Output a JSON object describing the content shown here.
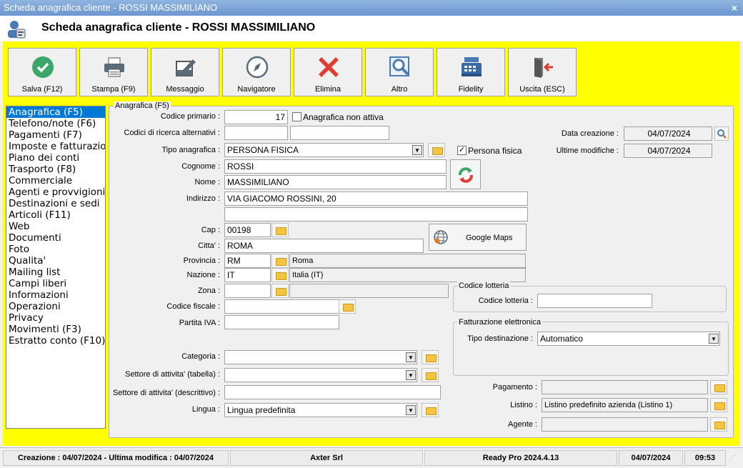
{
  "window": {
    "title": "Scheda anagrafica cliente - ROSSI MASSIMILIANO",
    "close": "×"
  },
  "header": {
    "title": "Scheda anagrafica cliente - ROSSI MASSIMILIANO"
  },
  "toolbar": [
    {
      "label": "Salva (F12)",
      "icon": "check-icon"
    },
    {
      "label": "Stampa (F9)",
      "icon": "printer-icon"
    },
    {
      "label": "Messaggio",
      "icon": "message-icon"
    },
    {
      "label": "Navigatore",
      "icon": "compass-icon"
    },
    {
      "label": "Elimina",
      "icon": "delete-icon"
    },
    {
      "label": "Altro",
      "icon": "magnifier-icon"
    },
    {
      "label": "Fidelity",
      "icon": "register-icon"
    },
    {
      "label": "Uscita (ESC)",
      "icon": "exit-icon"
    }
  ],
  "nav": [
    "Anagrafica (F5)",
    "Telefono/note (F6)",
    "Pagamenti (F7)",
    "Imposte e fatturazio",
    "Piano dei conti",
    "Trasporto (F8)",
    "Commerciale",
    "Agenti e provvigioni",
    "Destinazioni e sedi",
    "Articoli (F11)",
    "Web",
    "Documenti",
    "Foto",
    "Qualita'",
    "Mailing list",
    "Campi liberi",
    "Informazioni",
    "Operazioni",
    "Privacy",
    "Movimenti (F3)",
    "Estratto conto (F10)"
  ],
  "form": {
    "group_title": "Anagrafica (F5)",
    "codice_primario": {
      "label": "Codice primario :",
      "value": "17"
    },
    "anagrafica_non_attiva": {
      "label": "Anagrafica non attiva",
      "checked": false
    },
    "codici_ricerca": {
      "label": "Codici di ricerca alternativi :",
      "value1": "",
      "value2": ""
    },
    "tipo_anagrafica": {
      "label": "Tipo anagrafica :",
      "value": "PERSONA FISICA"
    },
    "persona_fisica": {
      "label": "Persona fisica",
      "checked": true
    },
    "cognome": {
      "label": "Cognome :",
      "value": "ROSSI"
    },
    "nome": {
      "label": "Nome :",
      "value": "MASSIMILIANO"
    },
    "indirizzo": {
      "label": "Indirizzo :",
      "value": "VIA GIACOMO ROSSINI, 20",
      "value2": ""
    },
    "cap": {
      "label": "Cap :",
      "value": "00198"
    },
    "google_maps": "Google Maps",
    "citta": {
      "label": "Citta' :",
      "value": "ROMA"
    },
    "provincia": {
      "label": "Provincia :",
      "value": "RM",
      "desc": "Roma"
    },
    "nazione": {
      "label": "Nazione :",
      "value": "IT",
      "desc": "Italia (IT)"
    },
    "zona": {
      "label": "Zona :",
      "value": "",
      "desc": ""
    },
    "codice_fiscale": {
      "label": "Codice fiscale :",
      "value": ""
    },
    "partita_iva": {
      "label": "Partita IVA :",
      "value": ""
    },
    "categoria": {
      "label": "Categoria :",
      "value": ""
    },
    "settore_tabella": {
      "label": "Settore di attivita' (tabella) :",
      "value": ""
    },
    "settore_descr": {
      "label": "Settore di attivita' (descrittivo) :",
      "value": ""
    },
    "lingua": {
      "label": "Lingua :",
      "value": "Lingua predefinita"
    },
    "data_creazione": {
      "label": "Data creazione :",
      "value": "04/07/2024"
    },
    "ultime_modifiche": {
      "label": "Ultime modifiche :",
      "value": "04/07/2024"
    },
    "lotteria": {
      "group": "Codice lotteria",
      "label": "Codice lotteria :",
      "value": ""
    },
    "fatturazione": {
      "group": "Fatturazione elettronica",
      "label": "Tipo destinazione :",
      "value": "Automatico"
    },
    "pagamento": {
      "label": "Pagamento :",
      "value": ""
    },
    "listino": {
      "label": "Listino :",
      "value": "Listino predefinito azienda (Listino 1)"
    },
    "agente": {
      "label": "Agente :",
      "value": ""
    }
  },
  "status": {
    "dates": "Creazione : 04/07/2024 - Ultima modifica : 04/07/2024",
    "company": "Axter Srl",
    "version": "Ready Pro 2024.4.13",
    "date": "04/07/2024",
    "time": "09:53"
  }
}
